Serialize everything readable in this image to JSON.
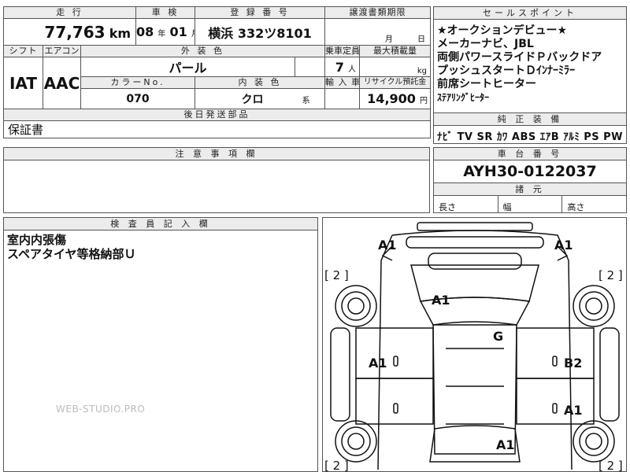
{
  "sheet": {
    "headers": {
      "mileage": "走 行",
      "shaken": "車 検",
      "reg_no": "登 録 番 号",
      "transfer_deadline": "譲渡書類期限",
      "shift": "シフト",
      "aircon": "エアコン",
      "ext_color": "外 装 色",
      "capacity": "乗車定員",
      "max_load": "最大積載量",
      "color_no": "カラーNo.",
      "int_color": "内 装 色",
      "import": "輸 入 車",
      "recycle": "リサイクル預託金",
      "later_parts": "後日発送部品",
      "notes": "注 意 事 項 欄",
      "inspector": "検 査 員 記 入 欄",
      "sales_points": "セールスポイント",
      "equipment": "純 正 装 備",
      "chassis_no": "車 台 番 号",
      "dimensions": "諸 元"
    },
    "mileage": {
      "value": "77,763",
      "unit": "km"
    },
    "shaken": {
      "year": "08",
      "year_unit": "年",
      "month": "01",
      "month_unit": "月"
    },
    "reg_no": "横浜 332ツ8101",
    "transfer_deadline": {
      "month_unit": "月",
      "day_unit": "日"
    },
    "shift": "IAT",
    "aircon": "AAC",
    "ext_color": "パール",
    "capacity": {
      "value": "7",
      "unit": "人"
    },
    "max_load": {
      "unit": "kg"
    },
    "color_no": "070",
    "int_color": {
      "value": "クロ",
      "suffix": "系"
    },
    "recycle": {
      "value": "14,900",
      "unit": "円"
    },
    "later_parts": "保証書",
    "inspector_notes": [
      "室内内張傷",
      "スペアタイヤ等格納部Ｕ"
    ],
    "sales_points": [
      "★オークションデビュー★",
      "メーカーナビ、JBL",
      "両側パワースライドＰバックドア",
      "プッシュスタートＤｲﾝﾅｰﾐﾗｰ",
      "前席シートヒーター",
      "ｽﾃｱﾘﾝｸﾞﾋｰﾀｰ"
    ],
    "equipment": "ﾅﾋﾞ TV SR ｶﾜ ABS ｴｱB ｱﾙﾐ PS PW",
    "chassis_no": "AYH30-0122037",
    "dimensions": {
      "length": "長さ",
      "width": "幅",
      "height": "高さ"
    }
  },
  "diagram": {
    "marks": {
      "front_left": "A1",
      "front_right": "A1",
      "hood": "A1",
      "roof": "G",
      "left_front_door": "A1",
      "right_front_door": "B2",
      "right_rear_door": "A1",
      "rear": "A1"
    },
    "tire_labels": [
      "[ 2 ]",
      "[ 2 ]",
      "[ 2 ]",
      "[ 2 ]"
    ]
  },
  "watermark": "WEB-STUDIO.PRO"
}
